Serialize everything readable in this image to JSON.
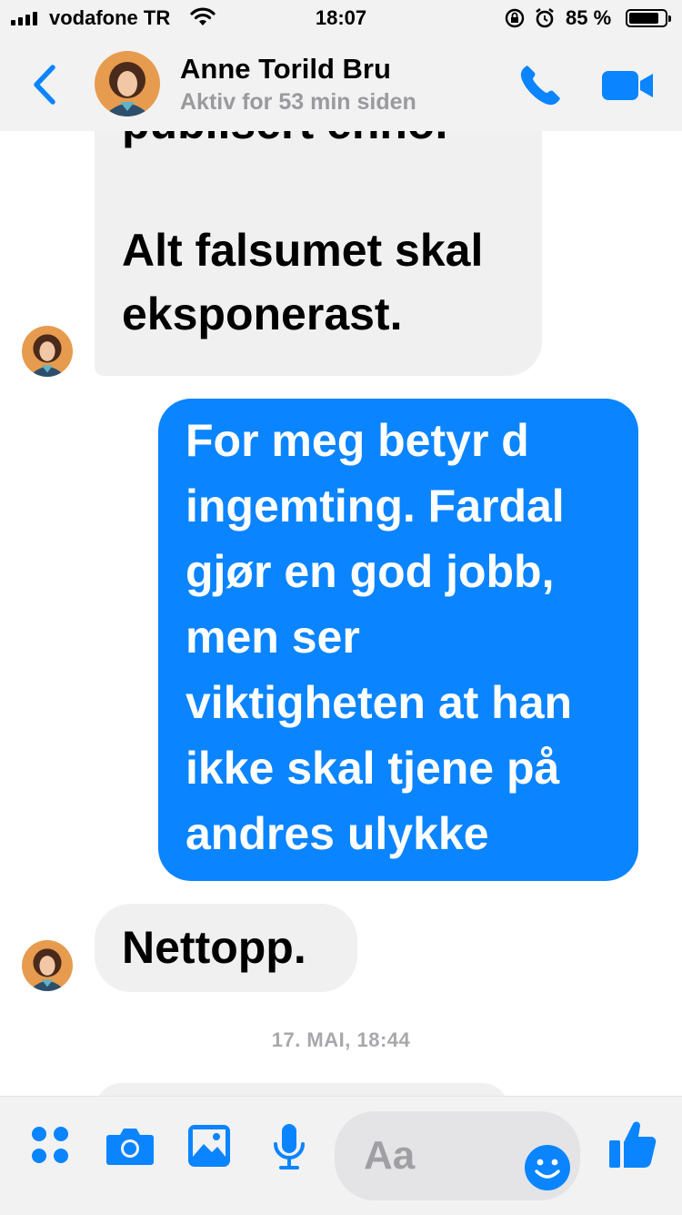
{
  "status_bar": {
    "carrier": "vodafone TR",
    "time": "18:07",
    "battery_percent": "85 %",
    "battery_level": 0.85,
    "icons": [
      "signal-icon",
      "wifi-icon",
      "rotation-lock-icon",
      "alarm-icon",
      "battery-icon"
    ]
  },
  "header": {
    "contact_name": "Anne Torild Bru",
    "contact_status": "Aktiv for 53 min siden",
    "icons": [
      "back-chevron-icon",
      "phone-icon",
      "video-camera-icon"
    ],
    "accent_color": "#0a84ff"
  },
  "conversation": {
    "messages": [
      {
        "direction": "incoming",
        "lines": [
          "publisert enno.",
          "",
          "Alt falsumet skal",
          "eksponerast."
        ]
      },
      {
        "direction": "outgoing",
        "lines": [
          "For meg betyr d",
          "ingemting. Fardal",
          "gjør en god jobb,",
          "men ser",
          "viktigheten at han",
          "ikke skal tjene på",
          "andres ulykke"
        ]
      },
      {
        "direction": "incoming",
        "lines": [
          "Nettopp."
        ]
      }
    ],
    "date_separator": "17. MAI, 18:44"
  },
  "composer": {
    "placeholder": "Aa",
    "icons": [
      "apps-grid-icon",
      "camera-icon",
      "photo-icon",
      "microphone-icon",
      "emoji-icon",
      "thumbs-up-icon"
    ]
  },
  "colors": {
    "outgoing_bubble": "#0a84ff",
    "incoming_bubble": "#f0f0f0",
    "bar_background": "#f2f2f3",
    "status_gray": "#9a9a9e"
  }
}
